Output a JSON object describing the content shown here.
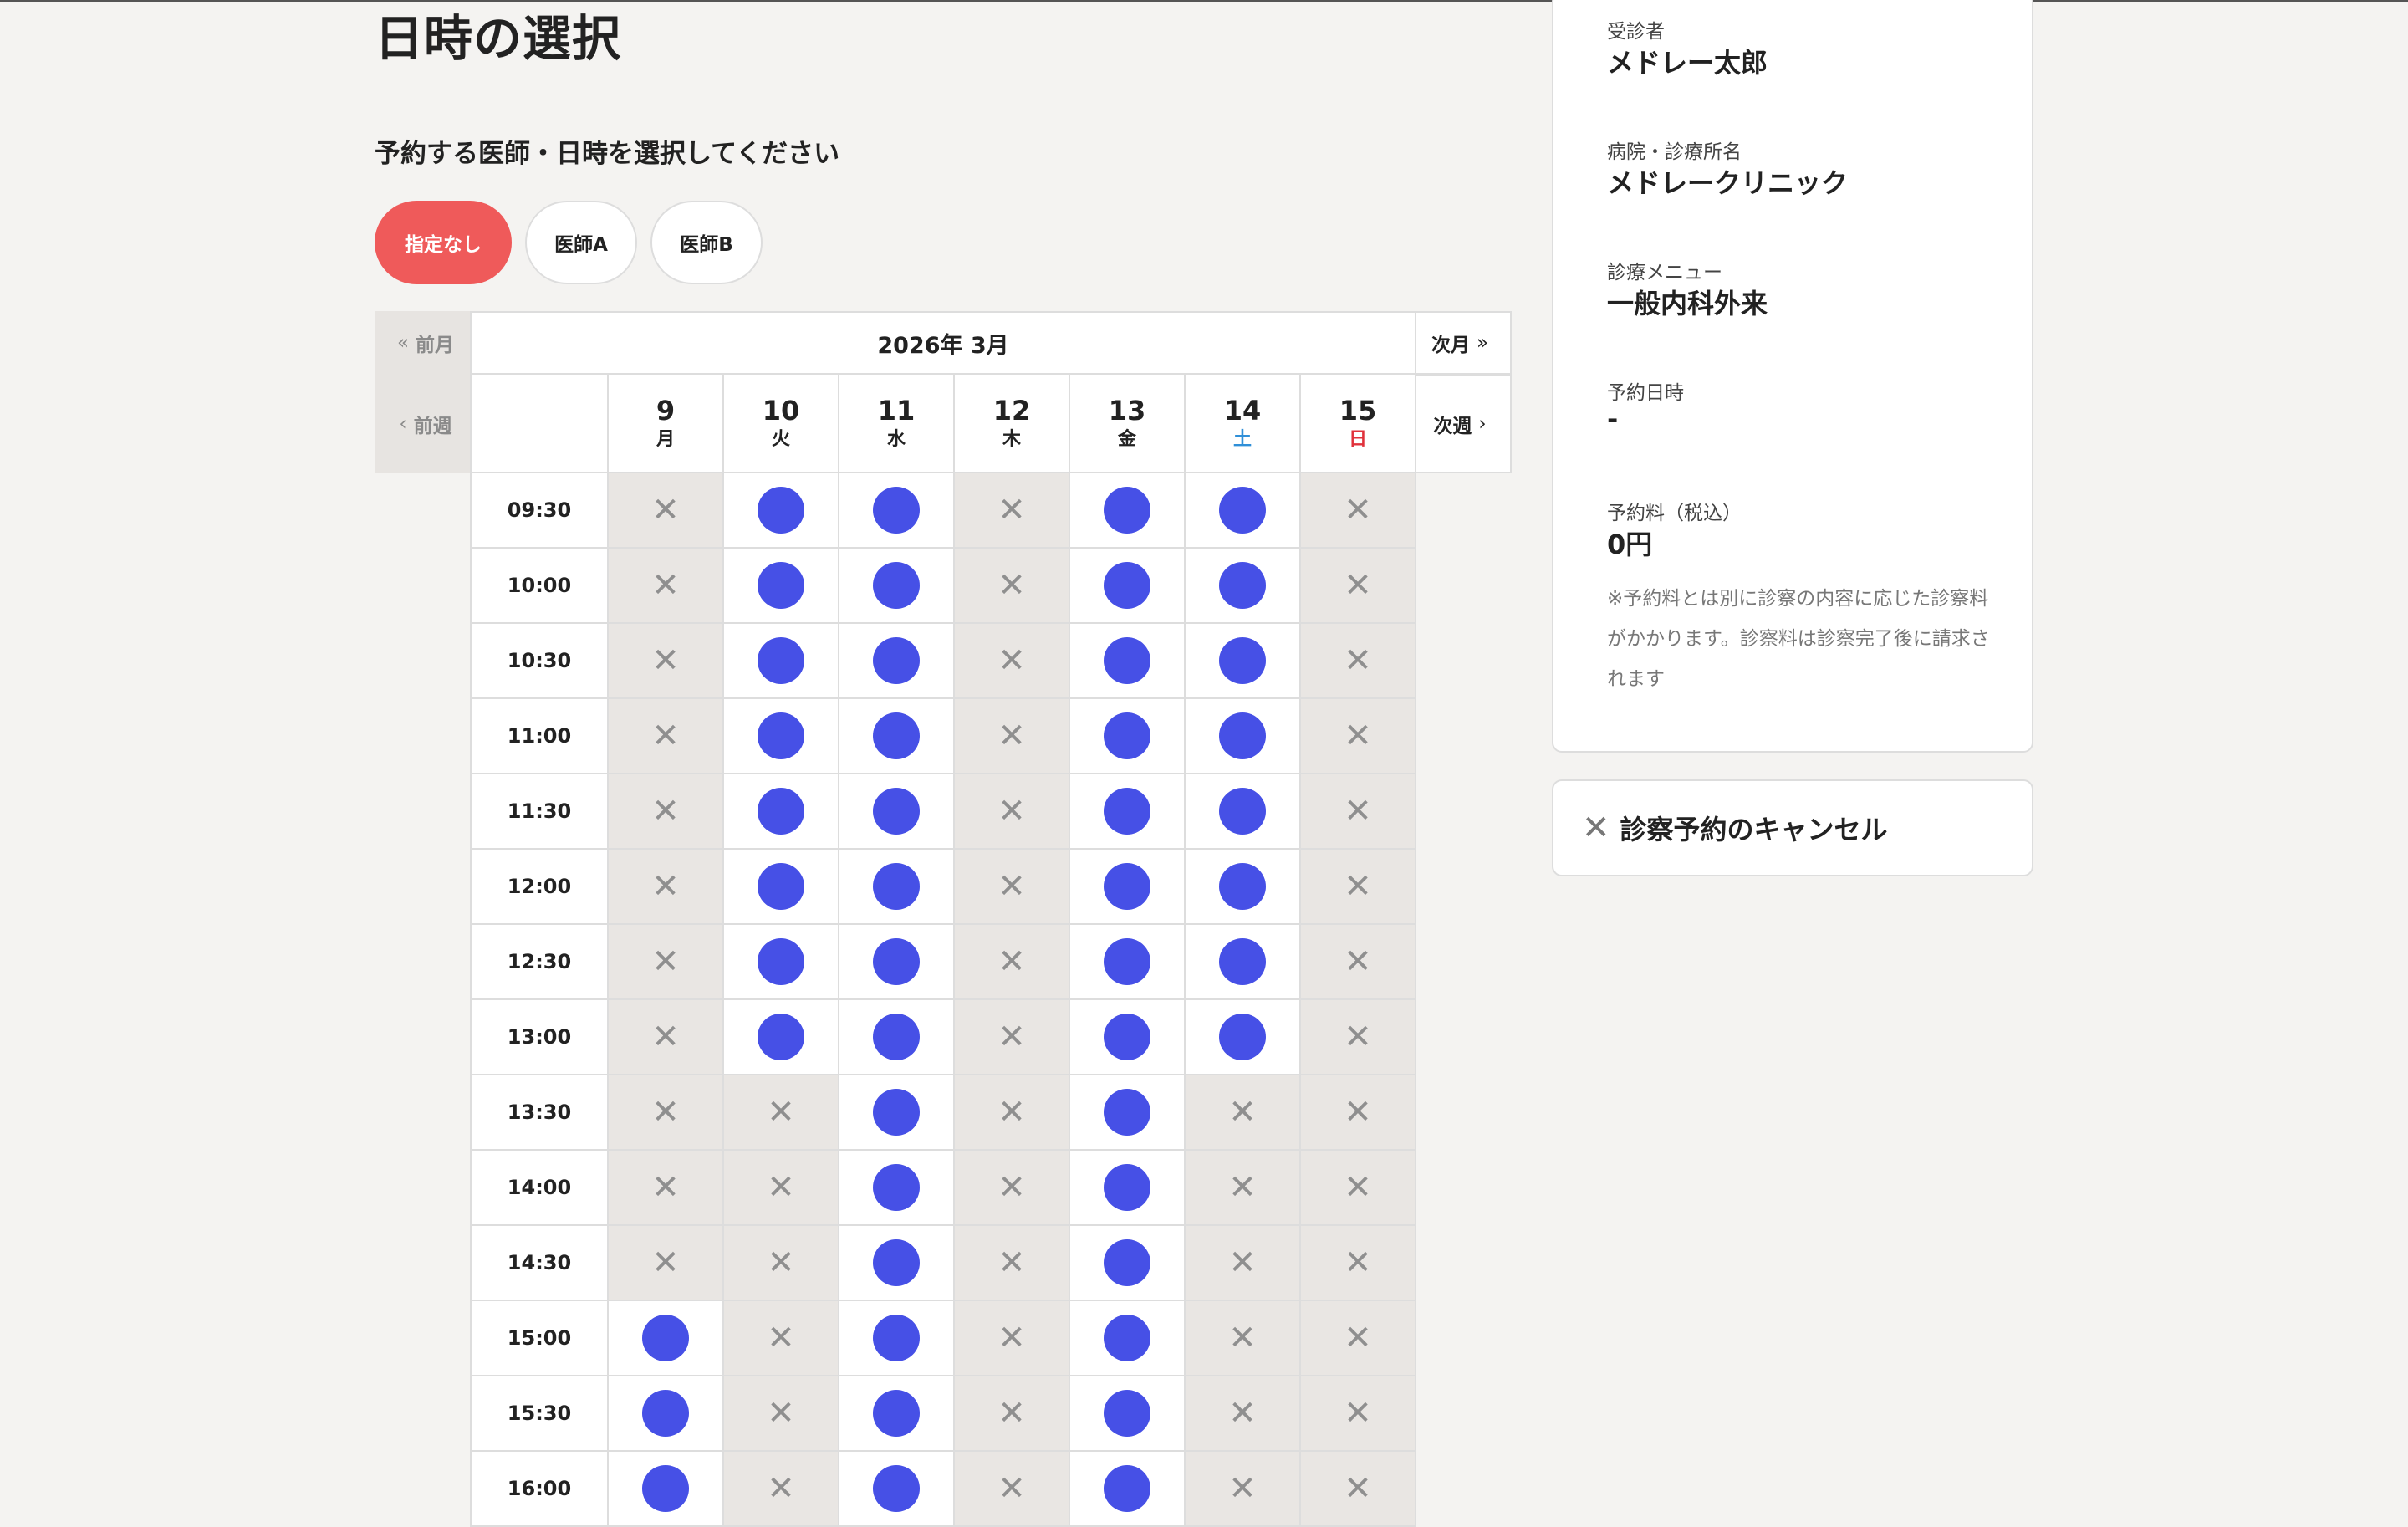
{
  "page": {
    "title": "日時の選択",
    "subtitle": "予約する医師・日時を選択してください"
  },
  "doctor_filter": {
    "options": [
      {
        "label": "指定なし",
        "selected": true
      },
      {
        "label": "医師A",
        "selected": false
      },
      {
        "label": "医師B",
        "selected": false
      }
    ]
  },
  "calendar": {
    "month_label": "2026年 3月",
    "prev_month": "前月",
    "next_month": "次月",
    "prev_week": "前週",
    "next_week": "次週",
    "days": [
      {
        "date": "9",
        "weekday": "月",
        "color": "#222222"
      },
      {
        "date": "10",
        "weekday": "火",
        "color": "#222222"
      },
      {
        "date": "11",
        "weekday": "水",
        "color": "#222222"
      },
      {
        "date": "12",
        "weekday": "木",
        "color": "#222222"
      },
      {
        "date": "13",
        "weekday": "金",
        "color": "#222222"
      },
      {
        "date": "14",
        "weekday": "土",
        "color": "#2f8fd8"
      },
      {
        "date": "15",
        "weekday": "日",
        "color": "#e0313b"
      }
    ],
    "slots": [
      {
        "time": "09:30",
        "availability": [
          0,
          1,
          1,
          0,
          1,
          1,
          0
        ]
      },
      {
        "time": "10:00",
        "availability": [
          0,
          1,
          1,
          0,
          1,
          1,
          0
        ]
      },
      {
        "time": "10:30",
        "availability": [
          0,
          1,
          1,
          0,
          1,
          1,
          0
        ]
      },
      {
        "time": "11:00",
        "availability": [
          0,
          1,
          1,
          0,
          1,
          1,
          0
        ]
      },
      {
        "time": "11:30",
        "availability": [
          0,
          1,
          1,
          0,
          1,
          1,
          0
        ]
      },
      {
        "time": "12:00",
        "availability": [
          0,
          1,
          1,
          0,
          1,
          1,
          0
        ]
      },
      {
        "time": "12:30",
        "availability": [
          0,
          1,
          1,
          0,
          1,
          1,
          0
        ]
      },
      {
        "time": "13:00",
        "availability": [
          0,
          1,
          1,
          0,
          1,
          1,
          0
        ]
      },
      {
        "time": "13:30",
        "availability": [
          0,
          0,
          1,
          0,
          1,
          0,
          0
        ]
      },
      {
        "time": "14:00",
        "availability": [
          0,
          0,
          1,
          0,
          1,
          0,
          0
        ]
      },
      {
        "time": "14:30",
        "availability": [
          0,
          0,
          1,
          0,
          1,
          0,
          0
        ]
      },
      {
        "time": "15:00",
        "availability": [
          1,
          0,
          1,
          0,
          1,
          0,
          0
        ]
      },
      {
        "time": "15:30",
        "availability": [
          1,
          0,
          1,
          0,
          1,
          0,
          0
        ]
      },
      {
        "time": "16:00",
        "availability": [
          1,
          0,
          1,
          0,
          1,
          0,
          0
        ]
      }
    ],
    "available_color": "#4650e6"
  },
  "summary": {
    "patient_label": "受診者",
    "patient_value": "メドレー太郎",
    "clinic_label": "病院・診療所名",
    "clinic_value": "メドレークリニック",
    "menu_label": "診療メニュー",
    "menu_value": "一般内科外来",
    "datetime_label": "予約日時",
    "datetime_value": "-",
    "fee_label": "予約料（税込）",
    "fee_value": "0円",
    "note": "※予約料とは別に診察の内容に応じた診察料がかかります。診察料は診察完了後に請求されます"
  },
  "cancel": {
    "label": "診察予約のキャンセル",
    "icon": "close-icon"
  },
  "icons": {
    "prev_month": "double-chevron-left-icon",
    "next_month": "double-chevron-right-icon",
    "prev_week": "chevron-left-icon",
    "next_week": "chevron-right-icon",
    "available": "available-dot-icon",
    "unavailable": "cross-icon"
  }
}
